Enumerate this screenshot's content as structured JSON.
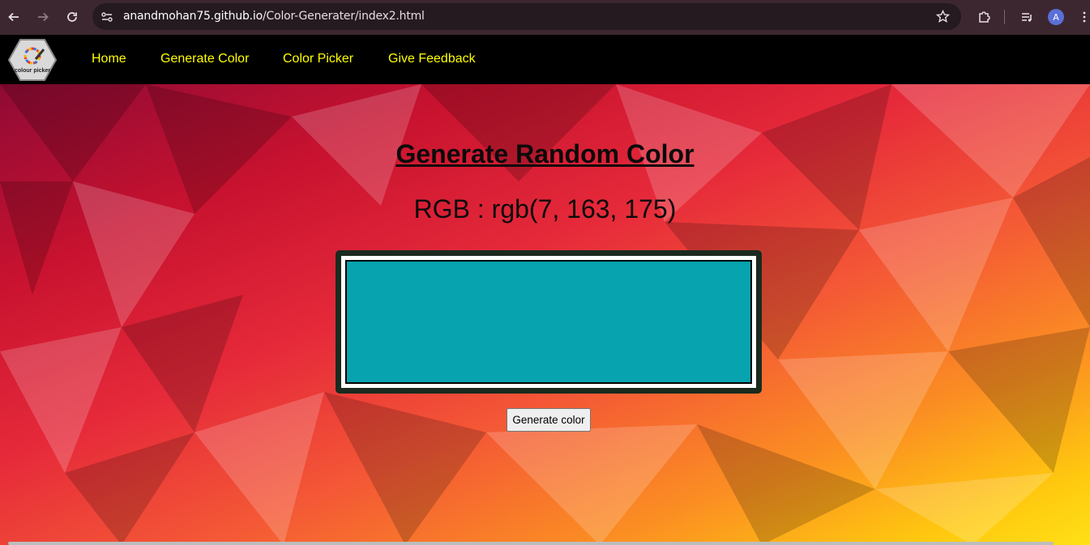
{
  "browser": {
    "url_host": "anandmohan75.github.io",
    "url_path": "/Color-Generater/index2.html",
    "profile_initial": "A",
    "icons": [
      "back-arrow-icon",
      "forward-arrow-icon",
      "reload-icon",
      "site-settings-icon",
      "bookmark-star-icon",
      "extensions-icon",
      "media-queue-icon",
      "kebab-menu-icon"
    ]
  },
  "nav": {
    "logo_text": "colour picker",
    "links": [
      {
        "label": "Home"
      },
      {
        "label": "Generate Color"
      },
      {
        "label": "Color Picker"
      },
      {
        "label": "Give Feedback"
      }
    ],
    "link_color": "#ffff00"
  },
  "main": {
    "heading": "Generate Random Color",
    "rgb_text": "RGB : rgb(7, 163, 175)",
    "current_color": "rgb(7, 163, 175)",
    "button_label": "Generate color"
  }
}
